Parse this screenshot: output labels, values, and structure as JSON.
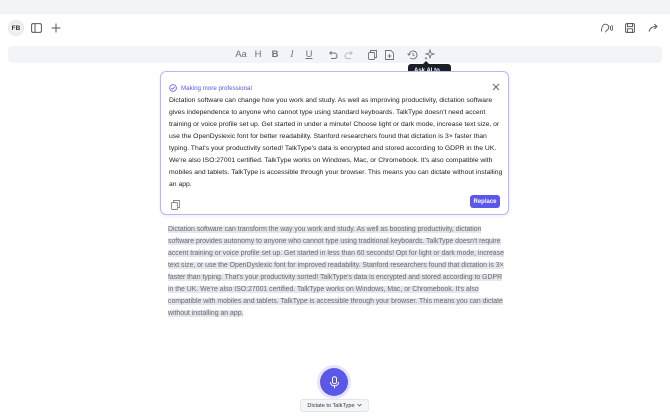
{
  "header": {
    "avatar_initials": "FB"
  },
  "toolbar": {
    "font_size_label": "Aa",
    "heading_label": "H",
    "bold_label": "B",
    "italic_label": "I",
    "underline_label": "U",
    "tooltip": "Ask AI to..."
  },
  "ai_panel": {
    "status": "Making more professional",
    "text": "Dictation software can change how you work and study. As well as improving productivity, dictation software gives independence to anyone who cannot type using standard keyboards. TalkType doesn't need accent training or voice profile set up. Get started in under a minute! Choose light or dark mode, increase text size, or use the OpenDyslexic font for better readability. Stanford researchers found that dictation is 3× faster than typing. That's your productivity sorted! TalkType's data is encrypted and stored according to GDPR in the UK. We're also ISO:27001 certified. TalkType works on Windows, Mac, or Chromebook. It's also compatible with mobiles and tablets. TalkType is accessible through your browser. This means you can dictate without installing an app.",
    "replace_label": "Replace"
  },
  "document": {
    "text": "Dictation software can transform the way you work and study. As well as boosting productivity, dictation software provides autonomy to anyone who cannot type using traditional keyboards. TalkType doesn't require accent training or voice profile set up. Get started in less than 60 seconds! Opt for light or dark mode, increase text size, or use the OpenDyslexic font for improved readability. Stanford researchers found that dictation is 3× faster than typing. That's your productivity sorted! TalkType's data is encrypted and stored according to GDPR in the UK. We're also ISO:27001 certified. TalkType works on Windows, Mac, or Chromebook. It's also compatible with mobiles and tablets. TalkType is accessible through your browser. This means you can dictate without installing an app."
  },
  "dictate": {
    "label": "Dictate to TalkType"
  },
  "colors": {
    "accent": "#5b57e9",
    "highlight": "#e4e6ec"
  }
}
